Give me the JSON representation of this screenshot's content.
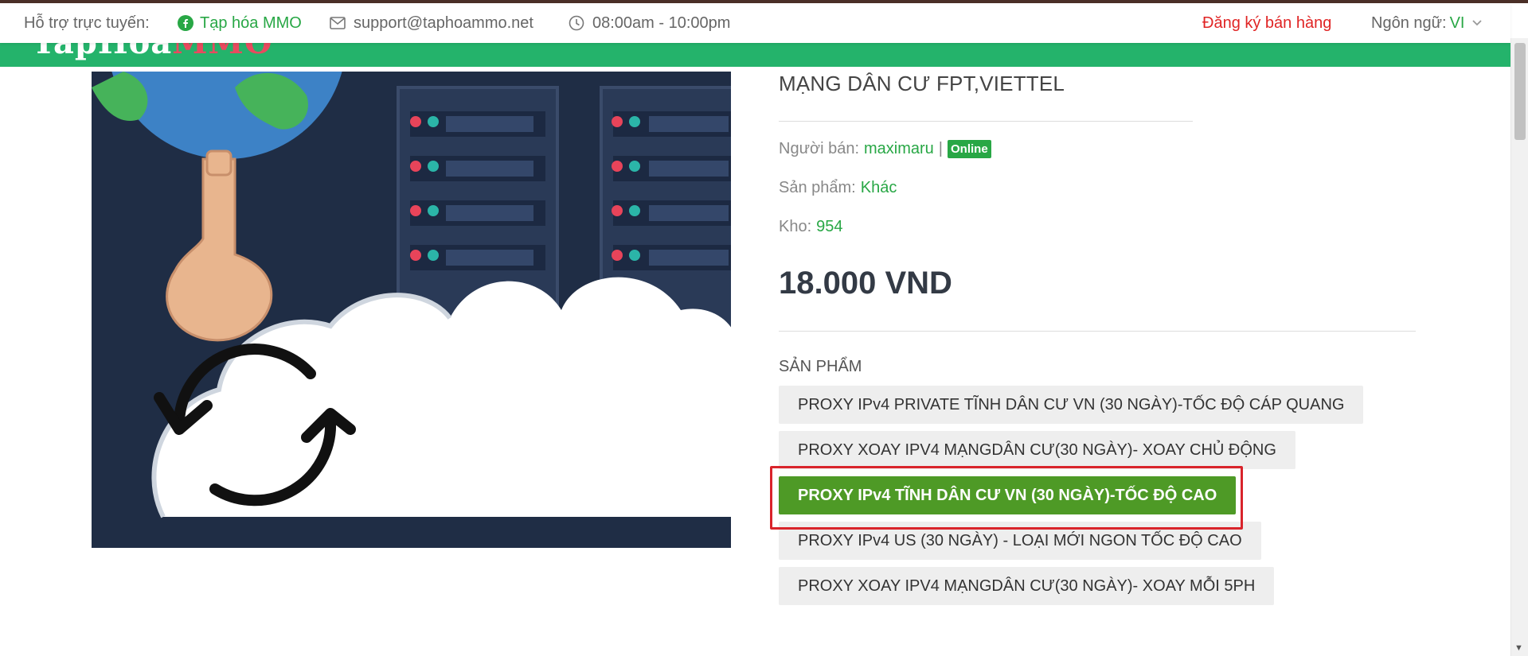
{
  "topbar": {
    "support_label": "Hỗ trợ trực tuyến:",
    "facebook_text": "Tạp hóa MMO",
    "email": "support@taphoammo.net",
    "hours": "08:00am - 10:00pm",
    "register_seller": "Đăng ký bán hàng",
    "language_label": "Ngôn ngữ:",
    "language_value": "VI"
  },
  "header": {
    "logo_main": "TapHoa",
    "logo_accent": "MMO"
  },
  "product": {
    "title_visible": "MẠNG DÂN CƯ FPT,VIETTEL",
    "seller_label": "Người bán:",
    "seller_name": "maximaru",
    "separator": "|",
    "online_badge": "Online",
    "category_label": "Sản phẩm:",
    "category_value": "Khác",
    "stock_label": "Kho:",
    "stock_value": "954",
    "price": "18.000 VND",
    "variants_label": "SẢN PHẨM",
    "variants": [
      {
        "label": "PROXY IPv4 PRIVATE TĨNH DÂN CƯ VN (30 NGÀY)-TỐC ĐỘ CÁP QUANG",
        "active": false
      },
      {
        "label": "PROXY XOAY IPV4 MẠNGDÂN CƯ(30 NGÀY)- XOAY CHỦ ĐỘNG",
        "active": false
      },
      {
        "label": "PROXY IPv4 TĨNH DÂN CƯ VN (30 NGÀY)-TỐC ĐỘ CAO",
        "active": true
      },
      {
        "label": "PROXY IPv4 US (30 NGÀY) - LOẠI MỚI NGON TỐC ĐỘ CAO",
        "active": false
      },
      {
        "label": "PROXY XOAY IPV4 MẠNGDÂN CƯ(30 NGÀY)- XOAY MỖI 5PH",
        "active": false
      }
    ]
  },
  "colors": {
    "brand_green": "#24b36b",
    "link_green": "#28a745",
    "active_variant": "#4e9a26",
    "highlight_red": "#d9242b",
    "register_red": "#e02424"
  }
}
